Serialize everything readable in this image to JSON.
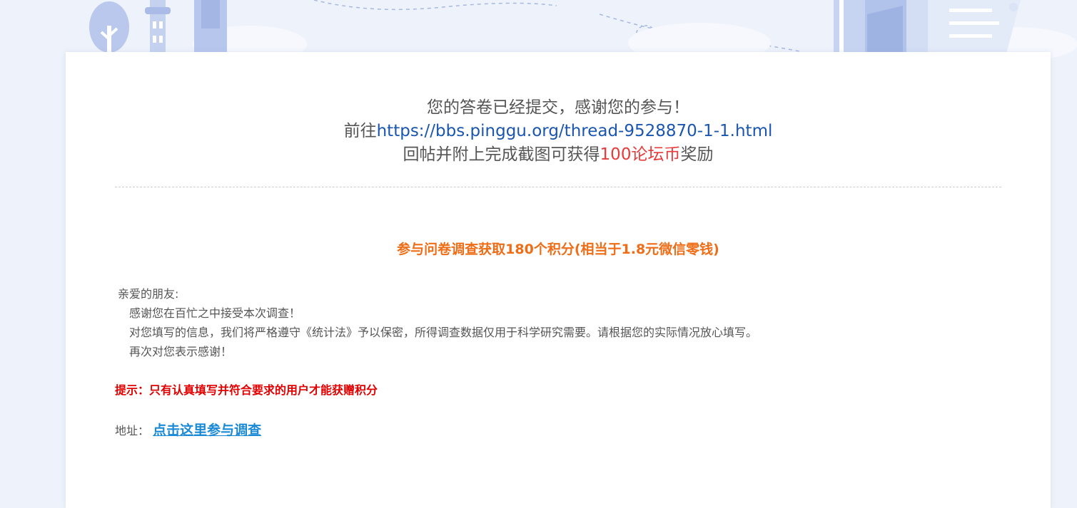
{
  "confirmation": {
    "line1": "您的答卷已经提交，感谢您的参与！",
    "line2_prefix": "前往",
    "line2_link": "https://bbs.pinggu.org/thread-9528870-1-1.html",
    "line3_prefix": "回帖并附上完成截图可获得",
    "line3_reward": "100论坛币",
    "line3_suffix": "奖励"
  },
  "survey": {
    "title": "参与问卷调查获取180个积分(相当于1.8元微信零钱)",
    "greeting": "亲爱的朋友:",
    "para1": "感谢您在百忙之中接受本次调查！",
    "para2": "对您填写的信息，我们将严格遵守《统计法》予以保密，所得调查数据仅用于科学研究需要。请根据您的实际情况放心填写。",
    "para3": "再次对您表示感谢！",
    "hint": "提示：只有认真填写并符合要求的用户才能获赠积分",
    "address_label": "地址：",
    "address_link": "点击这里参与调查"
  },
  "colors": {
    "link_blue": "#1a56b0",
    "reward_red": "#e83a3a",
    "title_orange": "#f06d17",
    "hint_red": "#e00000",
    "survey_link": "#1a8ad6"
  }
}
